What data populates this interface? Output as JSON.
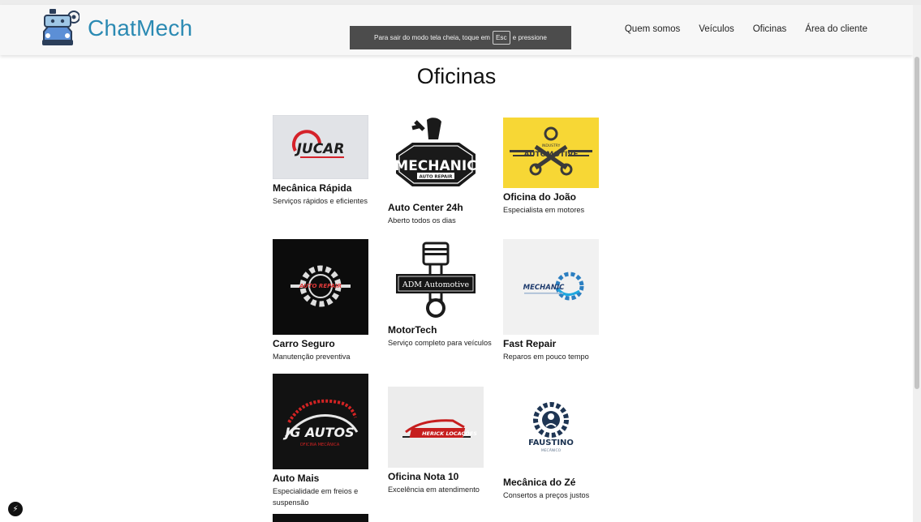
{
  "header": {
    "brand": "ChatMech",
    "nav": [
      "Quem somos",
      "Veículos",
      "Oficinas",
      "Área do cliente"
    ]
  },
  "fullscreen_notice": {
    "before": "Para sair do modo tela cheia, toque em",
    "key": "Esc",
    "after": "e pressione"
  },
  "page": {
    "title": "Oficinas"
  },
  "workshops": [
    {
      "name": "Mecânica Rápida",
      "desc": "Serviços rápidos e eficientes",
      "logo_text": "JUCAR"
    },
    {
      "name": "Auto Center 24h",
      "desc": "Aberto todos os dias",
      "logo_text": "MECHANIC",
      "logo_sub": "AUTO REPAIR"
    },
    {
      "name": "Oficina do João",
      "desc": "Especialista em motores",
      "logo_text": "AUTOMOTIVE",
      "logo_sub": "INDUSTRY"
    },
    {
      "name": "Carro Seguro",
      "desc": "Manutenção preventiva",
      "logo_text": "AUTO REPAIR"
    },
    {
      "name": "MotorTech",
      "desc": "Serviço completo para veículos",
      "logo_text": "ADM Automotive"
    },
    {
      "name": "Fast Repair",
      "desc": "Reparos em pouco tempo",
      "logo_text": "MECHANIC"
    },
    {
      "name": "Auto Mais",
      "desc": "Especialidade em freios e suspensão",
      "logo_text": "JG AUTOS",
      "logo_sub": "OFICINA MECÂNICA"
    },
    {
      "name": "Oficina Nota 10",
      "desc": "Excelência em atendimento",
      "logo_text": "HERICK LOCAÇÕES"
    },
    {
      "name": "Mecânica do Zé",
      "desc": "Consertos a preços justos",
      "logo_text": "FAUSTINO",
      "logo_sub": "MECÂNICO"
    }
  ],
  "colors": {
    "brand": "#2b8ab3",
    "toast_bg": "#4c4c4c",
    "yellow": "#f7d735"
  }
}
